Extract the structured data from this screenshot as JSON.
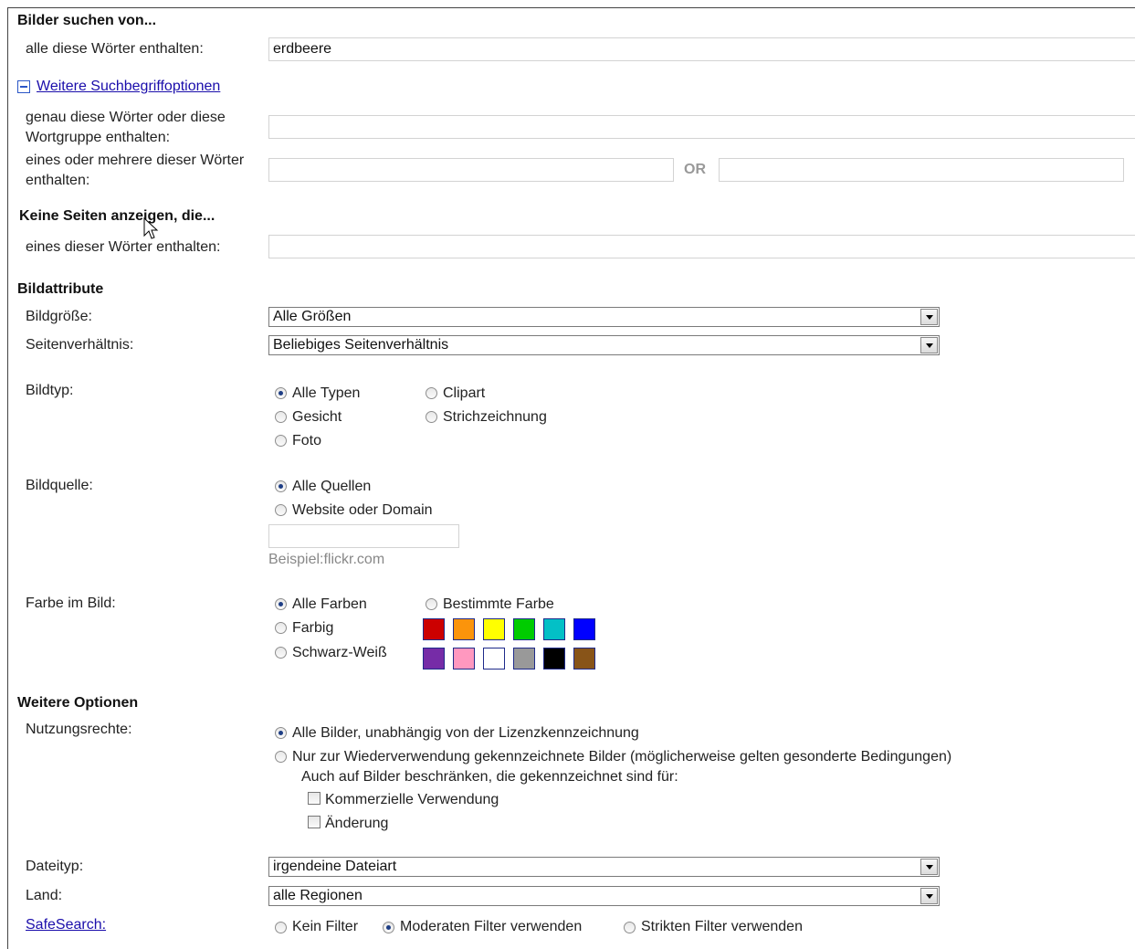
{
  "search": {
    "title": "Bilder suchen von...",
    "all_words_label": "alle diese Wörter enthalten:",
    "all_words_value": "erdbeere",
    "more_options_link": "Weitere Suchbegriffoptionen",
    "exact_phrase_label": "genau diese Wörter oder diese Wortgruppe enthalten:",
    "exact_phrase_value": "",
    "any_words_label": "eines oder mehrere dieser Wörter enthalten:",
    "any_words_value1": "",
    "or_text": "OR",
    "any_words_value2": ""
  },
  "exclude": {
    "title": "Keine Seiten anzeigen, die...",
    "none_words_label": "eines dieser Wörter enthalten:",
    "none_words_value": ""
  },
  "attributes": {
    "title": "Bildattribute",
    "size_label": "Bildgröße:",
    "size_value": "Alle Größen",
    "aspect_label": "Seitenverhältnis:",
    "aspect_value": "Beliebiges Seitenverhältnis",
    "type_label": "Bildtyp:",
    "type_options": [
      "Alle Typen",
      "Gesicht",
      "Foto",
      "Clipart",
      "Strichzeichnung"
    ],
    "source_label": "Bildquelle:",
    "source_options": [
      "Alle Quellen",
      "Website oder Domain"
    ],
    "source_value": "",
    "source_example": "Beispiel:flickr.com",
    "color_label": "Farbe im Bild:",
    "color_options": [
      "Alle Farben",
      "Farbig",
      "Schwarz-Weiß",
      "Bestimmte Farbe"
    ],
    "swatches": [
      "#cc0000",
      "#fb940b",
      "#ffff00",
      "#00cc00",
      "#03c0c6",
      "#0000ff",
      "#762ca7",
      "#ff98bf",
      "#ffffff",
      "#999999",
      "#000000",
      "#885418"
    ]
  },
  "more": {
    "title": "Weitere Optionen",
    "rights_label": "Nutzungsrechte:",
    "rights_options": [
      "Alle Bilder, unabhängig von der Lizenzkennzeichnung",
      "Nur zur Wiederverwendung gekennzeichnete Bilder (möglicherweise gelten gesonderte Bedingungen)"
    ],
    "restrict_text": "Auch auf Bilder beschränken, die gekennzeichnet sind für:",
    "check_commercial": "Kommerzielle Verwendung",
    "check_modification": "Änderung",
    "filetype_label": "Dateityp:",
    "filetype_value": "irgendeine Dateiart",
    "country_label": "Land:",
    "country_value": "alle Regionen",
    "safesearch_label": "SafeSearch:",
    "safesearch_options": [
      "Kein Filter",
      "Moderaten Filter verwenden",
      "Strikten Filter verwenden"
    ]
  }
}
